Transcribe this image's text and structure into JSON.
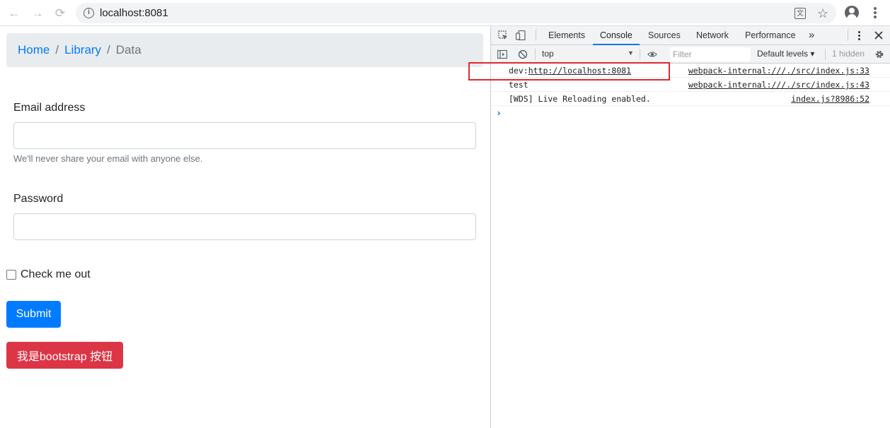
{
  "browser": {
    "url": "localhost:8081",
    "back_glyph": "←",
    "forward_glyph": "→",
    "reload_glyph": "⟳",
    "info_glyph": "i",
    "star_glyph": "☆",
    "translate_glyph": "文"
  },
  "breadcrumb": {
    "items": [
      "Home",
      "Library"
    ],
    "separator": "/",
    "active": "Data"
  },
  "form": {
    "email_label": "Email address",
    "email_value": "",
    "email_placeholder": "",
    "email_help": "We'll never share your email with anyone else.",
    "password_label": "Password",
    "password_value": "",
    "password_placeholder": "",
    "checkbox_label": "Check me out",
    "submit_label": "Submit",
    "danger_button_label": "我是bootstrap 按钮"
  },
  "devtools": {
    "tabs": [
      "Elements",
      "Console",
      "Sources",
      "Network",
      "Performance"
    ],
    "active_tab": "Console",
    "more_glyph": "»",
    "context": "top",
    "filter_placeholder": "Filter",
    "levels": "Default levels ▾",
    "hidden": "1 hidden",
    "console_lines": [
      {
        "prefix": "dev:",
        "link": "http://localhost:8081",
        "source": "webpack-internal:///./src/index.js:33"
      },
      {
        "prefix": "test",
        "link": "",
        "source": "webpack-internal:///./src/index.js:43"
      },
      {
        "prefix": "[WDS] Live Reloading enabled.",
        "link": "",
        "source": "index.js?8986:52"
      }
    ],
    "prompt_glyph": "›"
  },
  "colors": {
    "primary": "#007bff",
    "danger": "#dc3545",
    "highlight_box": "#e0282e",
    "devtools_accent": "#1a73e8"
  }
}
